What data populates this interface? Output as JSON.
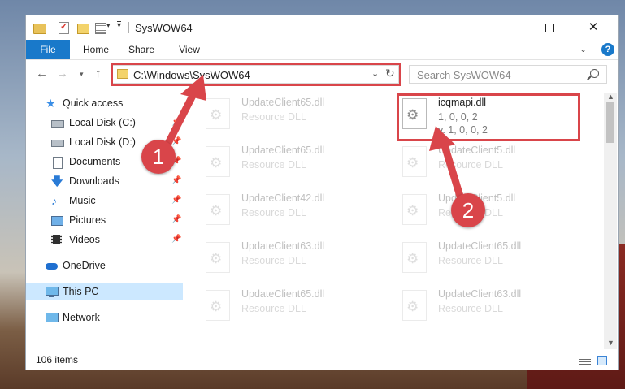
{
  "window": {
    "title": "SysWOW64"
  },
  "ribbon": {
    "file": "File",
    "home": "Home",
    "share": "Share",
    "view": "View",
    "help": "?"
  },
  "address": {
    "path": "C:\\Windows\\SysWOW64",
    "search_placeholder": "Search SysWOW64"
  },
  "sidebar": {
    "quick_access": "Quick access",
    "items": [
      {
        "label": "Local Disk (C:)"
      },
      {
        "label": "Local Disk (D:)"
      },
      {
        "label": "Documents"
      },
      {
        "label": "Downloads"
      },
      {
        "label": "Music"
      },
      {
        "label": "Pictures"
      },
      {
        "label": "Videos"
      }
    ],
    "onedrive": "OneDrive",
    "this_pc": "This PC",
    "network": "Network"
  },
  "files": [
    {
      "name": "UpdateClient65.dll",
      "type": "Resource DLL"
    },
    {
      "name": "icqmapi.dll",
      "line2": "1, 0, 0, 2",
      "line3": "v. 1, 0, 0, 2"
    },
    {
      "name": "UpdateClient65.dll",
      "type": "Resource DLL"
    },
    {
      "name": "UpdateClient5.dll",
      "type": "Resource DLL"
    },
    {
      "name": "UpdateClient42.dll",
      "type": "Resource DLL"
    },
    {
      "name": "UpdateClient5.dll",
      "type": "Resource DLL"
    },
    {
      "name": "UpdateClient63.dll",
      "type": "Resource DLL"
    },
    {
      "name": "UpdateClient65.dll",
      "type": "Resource DLL"
    },
    {
      "name": "UpdateClient65.dll",
      "type": "Resource DLL"
    },
    {
      "name": "UpdateClient63.dll",
      "type": "Resource DLL"
    }
  ],
  "status": {
    "count": "106 items"
  },
  "annotations": {
    "step1": "1",
    "step2": "2"
  },
  "colors": {
    "accent": "#1979ca",
    "highlight": "#d9454a",
    "selected": "#cce8ff"
  }
}
